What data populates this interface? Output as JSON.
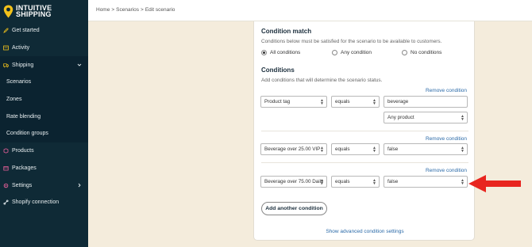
{
  "brand": {
    "line1": "INTUITIVE",
    "line2": "SHIPPING",
    "accent": "#f2c21b"
  },
  "breadcrumb": {
    "home": "Home",
    "sep1": ">",
    "scenarios": "Scenarios",
    "sep2": ">",
    "current": "Edit scenario"
  },
  "sidebar": {
    "items": [
      {
        "label": "Get started",
        "icon": "rocket-icon"
      },
      {
        "label": "Activity",
        "icon": "activity-icon"
      },
      {
        "label": "Shipping",
        "icon": "truck-icon"
      },
      {
        "label": "Scenarios"
      },
      {
        "label": "Zones"
      },
      {
        "label": "Rate blending"
      },
      {
        "label": "Condition groups"
      },
      {
        "label": "Products",
        "icon": "box-icon"
      },
      {
        "label": "Packages",
        "icon": "package-icon"
      },
      {
        "label": "Settings",
        "icon": "gear-icon"
      },
      {
        "label": "Shopify connection",
        "icon": "link-icon"
      }
    ]
  },
  "condition_match": {
    "title": "Condition match",
    "description": "Conditions below must be satisfied for the scenario to be available to customers.",
    "options": [
      "All conditions",
      "Any condition",
      "No conditions"
    ],
    "selected": "All conditions"
  },
  "conditions": {
    "title": "Conditions",
    "description": "Add conditions that will determine the scenario status.",
    "remove_label": "Remove condition",
    "rows": [
      {
        "field": "Product tag",
        "operator": "equals",
        "value": "beverage",
        "extra": "Any product"
      },
      {
        "field": "Beverage over 25.00 VIP",
        "operator": "equals",
        "value": "false"
      },
      {
        "field": "Beverage over 75.00 Daily",
        "operator": "equals",
        "value": "false"
      }
    ],
    "add_button": "Add another condition",
    "advanced_link": "Show advanced condition settings"
  },
  "annotation": {
    "color": "#e8251f"
  }
}
